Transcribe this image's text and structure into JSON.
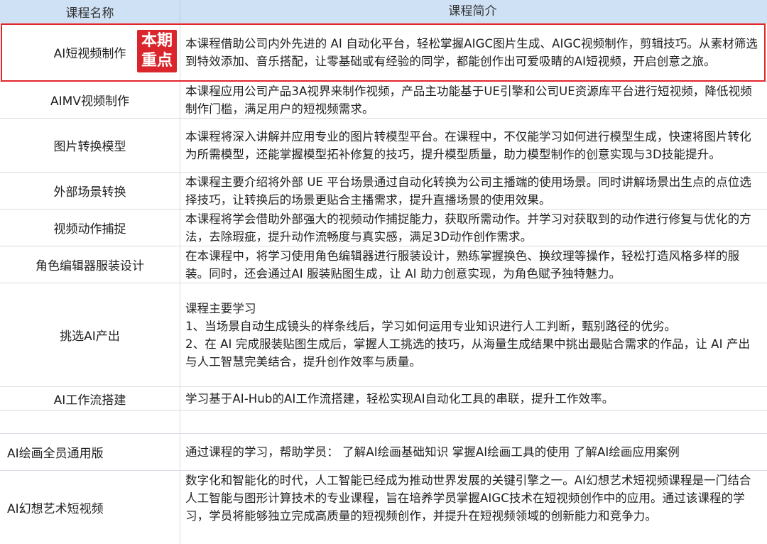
{
  "header": {
    "col_name": "课程名称",
    "col_desc": "课程简介"
  },
  "badge": {
    "line1": "本期",
    "line2": "重点"
  },
  "rows": [
    {
      "name": "AI短视频制作",
      "desc": "本课程借助公司内外先进的 AI 自动化平台，轻松掌握AIGC图片生成、AIGC视频制作，剪辑技巧。从素材筛选到特效添加、音乐搭配，让零基础或有经验的同学，都能创作出可爱吸睛的AI短视频，开启创意之旅。"
    },
    {
      "name": "AIMV视频制作",
      "desc": "本课程应用公司产品3A视界来制作视频，产品主功能基于UE引擎和公司UE资源库平台进行短视频，降低视频制作门槛，满足用户的短视频需求。"
    },
    {
      "name": "图片转换模型",
      "desc": "本课程将深入讲解并应用专业的图片转模型平台。在课程中，不仅能学习如何进行模型生成，快速将图片转化为所需模型，还能掌握模型拓补修复的技巧，提升模型质量，助力模型制作的创意实现与3D技能提升。"
    },
    {
      "name": "外部场景转换",
      "desc": "本课程主要介绍将外部 UE 平台场景通过自动化转换为公司主播端的使用场景。同时讲解场景出生点的点位选择技巧，让转换后的场景更贴合主播需求，提升直播场景的使用效果。"
    },
    {
      "name": "视频动作捕捉",
      "desc": "本课程将学会借助外部强大的视频动作捕捉能力，获取所需动作。并学习对获取到的动作进行修复与优化的方法，去除瑕疵，提升动作流畅度与真实感，满足3D动作创作需求。"
    },
    {
      "name": "角色编辑器服装设计",
      "desc": "在本课程中，将学习使用角色编辑器进行服装设计，熟练掌握换色、换纹理等操作，轻松打造风格多样的服装。同时，还会通过AI 服装贴图生成，让 AI 助力创意实现，为角色赋予独特魅力。"
    },
    {
      "name": "挑选AI产出",
      "desc": "课程主要学习\n1、当场景自动生成镜头的样条线后，学习如何运用专业知识进行人工判断，甄别路径的优劣。\n2、在 AI 完成服装贴图生成后，掌握人工挑选的技巧，从海量生成结果中挑出最贴合需求的作品，让 AI 产出与人工智慧完美结合，提升创作效率与质量。"
    },
    {
      "name": "AI工作流搭建",
      "desc": "学习基于AI-Hub的AI工作流搭建，轻松实现AI自动化工具的串联，提升工作效率。"
    },
    {
      "name": "",
      "desc": ""
    },
    {
      "name": "AI绘画全员通用版",
      "desc": "通过课程的学习，帮助学员： 了解AI绘画基础知识 掌握AI绘画工具的使用 了解AI绘画应用案例"
    },
    {
      "name": "AI幻想艺术短视频",
      "desc": "数字化和智能化的时代，人工智能已经成为推动世界发展的关键引擎之一。AI幻想艺术短视频课程是一门结合人工智能与图形计算技术的专业课程，旨在培养学员掌握AIGC技术在短视频创作中的应用。通过该课程的学习，学员将能够独立完成高质量的短视频创作，并提升在短视频领域的创新能力和竞争力。"
    }
  ],
  "colors": {
    "header_bg": "#cfe1f5",
    "highlight": "#e3262c",
    "badge_bg": "#d9252b",
    "grid": "#d8dde3"
  }
}
